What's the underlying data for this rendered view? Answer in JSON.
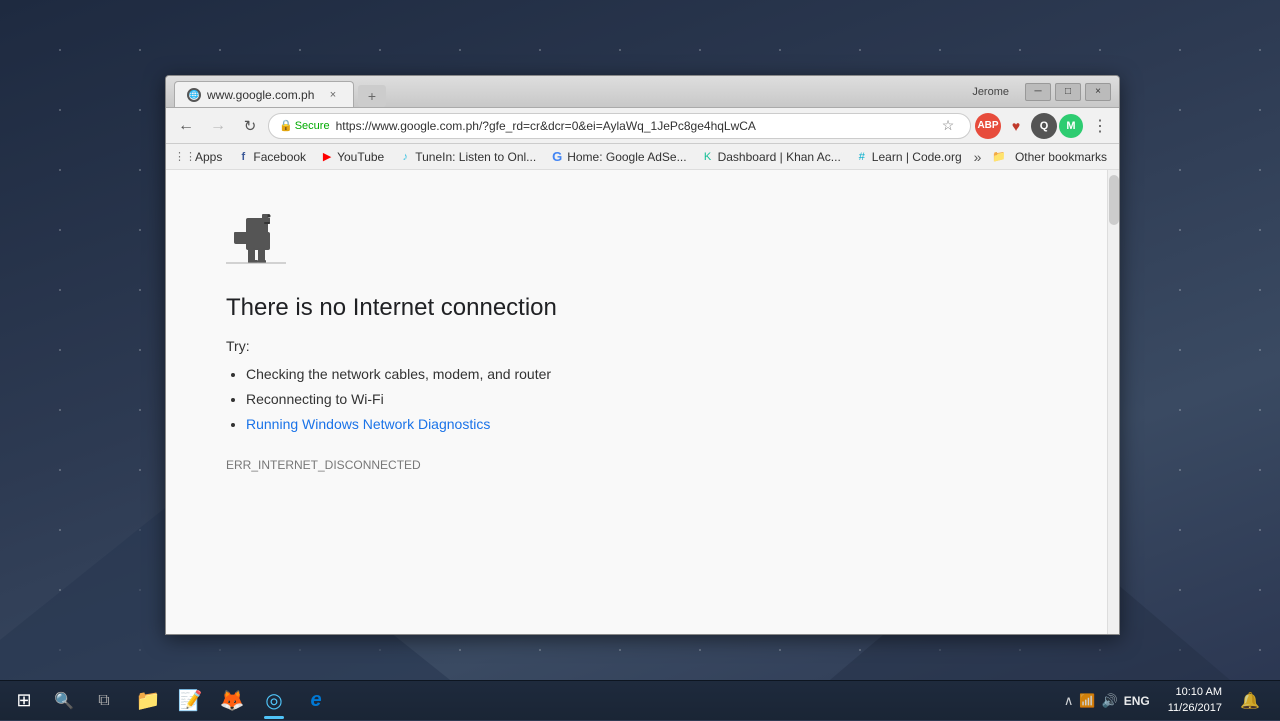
{
  "desktop": {
    "background": "#2d3a52"
  },
  "browser": {
    "tab": {
      "favicon": "🌐",
      "title": "www.google.com.ph",
      "close_label": "×"
    },
    "new_tab_label": "+",
    "window_controls": {
      "minimize": "─",
      "maximize": "□",
      "close": "×"
    },
    "user_profile": "Jerome",
    "toolbar": {
      "back_label": "←",
      "forward_label": "→",
      "reload_label": "↻",
      "secure_label": "Secure",
      "address": "https://www.google.com.ph/?gfe_rd=cr&dcr=0&ei=AylaWq_1JePc8ge4hqLwCA",
      "star_label": "☆"
    },
    "extensions": {
      "abp_label": "ABP",
      "heart_label": "♥",
      "q_label": "Q",
      "avatar_label": "M"
    },
    "menu_label": "⋮",
    "bookmarks": [
      {
        "icon": "⋮⋮⋮",
        "label": "Apps",
        "color": "apps-dots"
      },
      {
        "icon": "f",
        "label": "Facebook",
        "color": "fb-color"
      },
      {
        "icon": "▶",
        "label": "YouTube",
        "color": "yt-color"
      },
      {
        "icon": "♪",
        "label": "TuneIn: Listen to Onl...",
        "color": "tunein-color"
      },
      {
        "icon": "G",
        "label": "Home: Google AdSe...",
        "color": "google-color"
      },
      {
        "icon": "K",
        "label": "Dashboard | Khan Ac...",
        "color": "khan-color"
      },
      {
        "icon": "#",
        "label": "Learn | Code.org",
        "color": "codeorg-color"
      }
    ],
    "bookmark_more": "»",
    "other_bookmarks_label": "Other bookmarks",
    "page": {
      "error_title": "There is no Internet connection",
      "try_label": "Try:",
      "suggestions": [
        "Checking the network cables, modem, and router",
        "Reconnecting to Wi-Fi"
      ],
      "link_text": "Running Windows Network Diagnostics",
      "error_code": "ERR_INTERNET_DISCONNECTED"
    }
  },
  "taskbar": {
    "start_icon": "⊞",
    "search_icon": "🔍",
    "task_view_icon": "⧉",
    "apps": [
      {
        "name": "file-explorer",
        "icon": "📁",
        "active": false
      },
      {
        "name": "sticky-notes",
        "icon": "📝",
        "active": false
      },
      {
        "name": "firefox",
        "icon": "🦊",
        "active": false
      },
      {
        "name": "chrome",
        "icon": "◎",
        "active": true
      },
      {
        "name": "edge",
        "icon": "e",
        "active": false
      }
    ],
    "tray": {
      "up_arrow": "∧",
      "network": "📶",
      "volume": "🔊",
      "language": "ENG"
    },
    "clock": {
      "time": "10:10 AM",
      "date": "11/26/2017"
    },
    "notification_icon": "🔔"
  }
}
